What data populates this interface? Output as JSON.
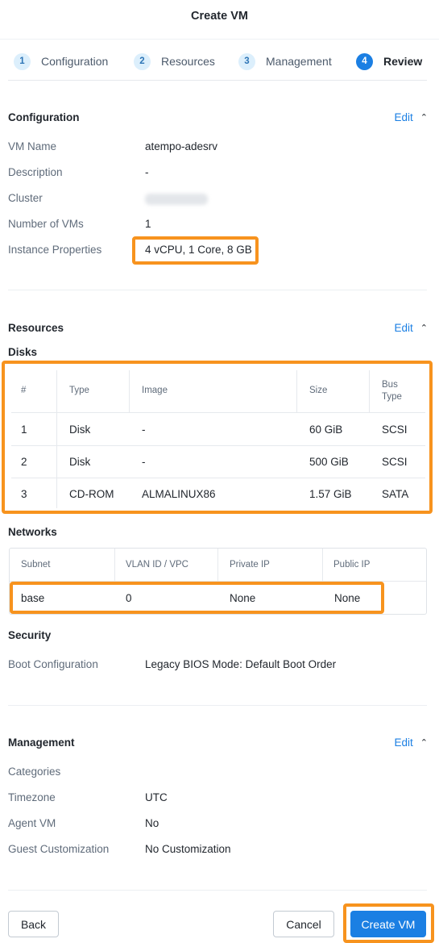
{
  "header": {
    "title": "Create VM"
  },
  "steps": [
    {
      "num": "1",
      "label": "Configuration"
    },
    {
      "num": "2",
      "label": "Resources"
    },
    {
      "num": "3",
      "label": "Management"
    },
    {
      "num": "4",
      "label": "Review"
    }
  ],
  "configuration": {
    "title": "Configuration",
    "edit": "Edit",
    "rows": [
      {
        "label": "VM Name",
        "value": "atempo-adesrv"
      },
      {
        "label": "Description",
        "value": "-"
      },
      {
        "label": "Cluster",
        "value": ""
      },
      {
        "label": "Number of VMs",
        "value": "1"
      },
      {
        "label": "Instance Properties",
        "value": "4 vCPU, 1 Core, 8 GB"
      }
    ]
  },
  "resources": {
    "title": "Resources",
    "edit": "Edit",
    "disks_title": "Disks",
    "disk_columns": [
      "#",
      "Type",
      "Image",
      "Size",
      "Bus Type"
    ],
    "disks": [
      [
        "1",
        "Disk",
        "-",
        "60 GiB",
        "SCSI"
      ],
      [
        "2",
        "Disk",
        "-",
        "500 GiB",
        "SCSI"
      ],
      [
        "3",
        "CD-ROM",
        "ALMALINUX86",
        "1.57 GiB",
        "SATA"
      ]
    ],
    "networks_title": "Networks",
    "network_columns": [
      "Subnet",
      "VLAN ID / VPC",
      "Private IP",
      "Public IP"
    ],
    "networks": [
      [
        "base",
        "0",
        "None",
        "None"
      ]
    ],
    "security_title": "Security",
    "security": {
      "label": "Boot Configuration",
      "value": "Legacy BIOS Mode: Default Boot Order"
    }
  },
  "management": {
    "title": "Management",
    "edit": "Edit",
    "rows": [
      {
        "label": "Categories",
        "value": ""
      },
      {
        "label": "Timezone",
        "value": "UTC"
      },
      {
        "label": "Agent VM",
        "value": "No"
      },
      {
        "label": "Guest Customization",
        "value": "No Customization"
      }
    ]
  },
  "footer": {
    "back": "Back",
    "cancel": "Cancel",
    "create": "Create VM"
  },
  "colors": {
    "accent": "#1b7fe3",
    "highlight": "#f7931e"
  }
}
